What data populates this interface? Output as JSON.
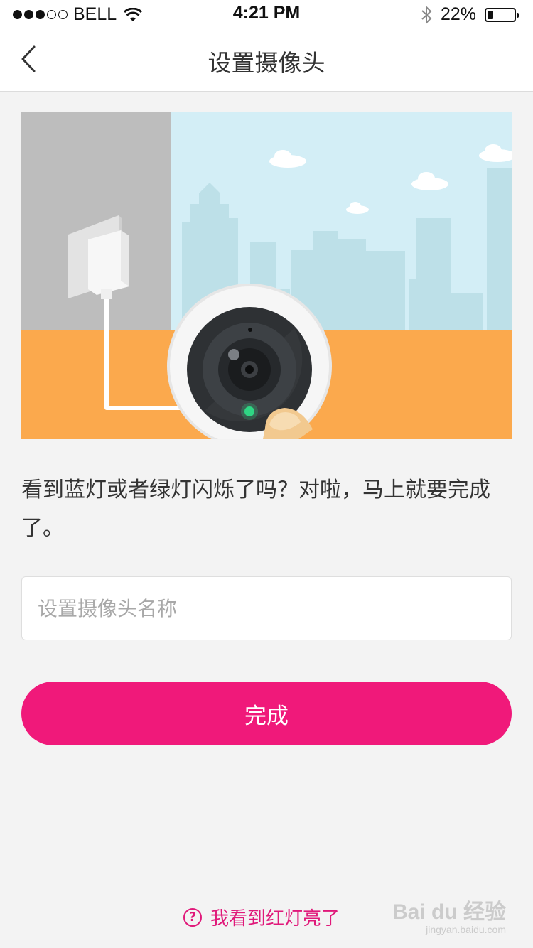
{
  "status_bar": {
    "carrier": "BELL",
    "signal_bars_filled": 3,
    "signal_bars_total": 5,
    "time": "4:21 PM",
    "battery_percent_label": "22%",
    "battery_level": 0.22,
    "icons": [
      "wifi-icon",
      "bluetooth-icon",
      "battery-icon"
    ]
  },
  "nav": {
    "title": "设置摄像头",
    "back_icon": "chevron-left-icon"
  },
  "hero": {
    "image": "camera-setup-illustration",
    "colors": {
      "wall": "#bdbdbd",
      "sky": "#d3eef6",
      "buildings": "#bde0e8",
      "floor": "#fba94d",
      "camera_ring": "#f1f1f1",
      "camera_face": "#2e3134",
      "led": "#2fd684"
    }
  },
  "instruction": {
    "text": "看到蓝灯或者绿灯闪烁了吗？对啦，马上就要完成了。"
  },
  "name_field": {
    "placeholder": "设置摄像头名称",
    "value": ""
  },
  "done_button": {
    "label": "完成",
    "color": "#f0197a"
  },
  "help_link": {
    "label": "我看到红灯亮了",
    "icon": "question-circle-icon",
    "color": "#e0197a"
  },
  "watermark": {
    "logo": "Bai du 经验",
    "url": "jingyan.baidu.com"
  }
}
